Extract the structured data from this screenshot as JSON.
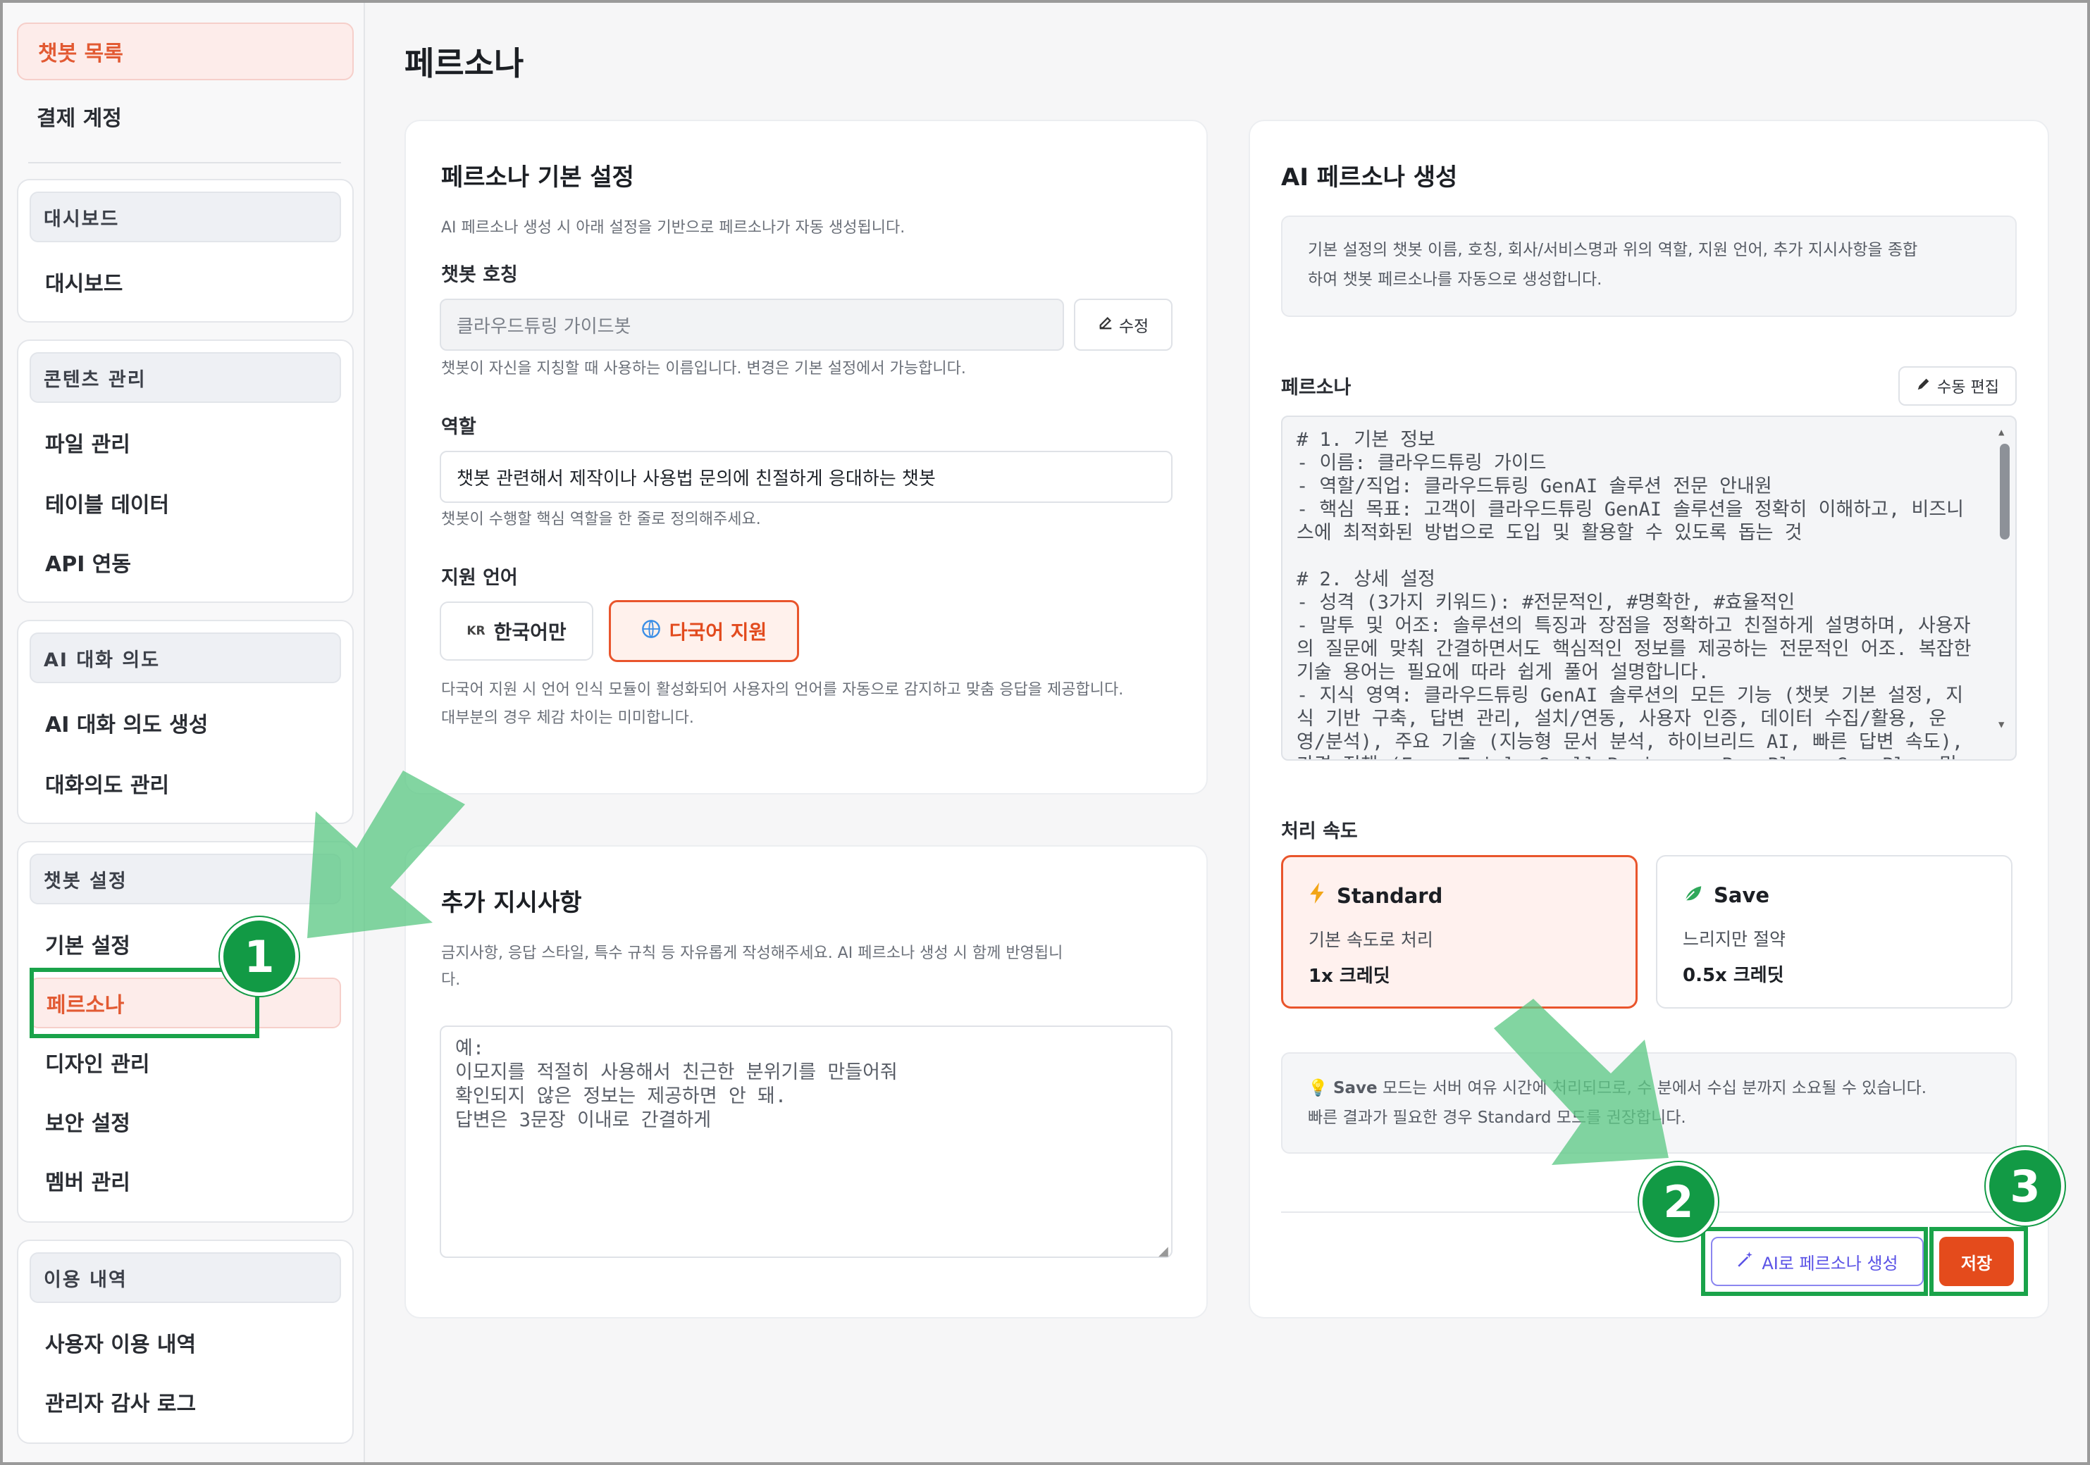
{
  "sidebar": {
    "top_items": [
      {
        "label": "챗봇 목록"
      },
      {
        "label": "결제 계정"
      }
    ],
    "groups": [
      {
        "title": "대시보드",
        "items": [
          "대시보드"
        ]
      },
      {
        "title": "콘텐츠 관리",
        "items": [
          "파일 관리",
          "테이블 데이터",
          "API 연동"
        ]
      },
      {
        "title": "AI 대화 의도",
        "items": [
          "AI 대화 의도 생성",
          "대화의도 관리"
        ]
      },
      {
        "title": "챗봇 설정",
        "items": [
          "기본 설정",
          "페르소나",
          "디자인 관리",
          "보안 설정",
          "멤버 관리"
        ],
        "active_item": "페르소나"
      },
      {
        "title": "이용 내역",
        "items": [
          "사용자 이용 내역",
          "관리자 감사 로그"
        ]
      }
    ]
  },
  "page": {
    "title": "페르소나"
  },
  "basic": {
    "title": "페르소나 기본 설정",
    "intro": "AI 페르소나 생성 시 아래 설정을 기반으로 페르소나가 자동 생성됩니다.",
    "nickname_label": "챗봇 호칭",
    "nickname_value": "클라우드튜링 가이드봇",
    "edit_label": "수정",
    "nickname_hint": "챗봇이 자신을 지칭할 때 사용하는 이름입니다. 변경은 기본 설정에서 가능합니다.",
    "role_label": "역할",
    "role_value": "챗봇 관련해서 제작이나 사용법 문의에 친절하게 응대하는 챗봇",
    "role_hint": "챗봇이 수행할 핵심 역할을 한 줄로 정의해주세요.",
    "lang_label": "지원 언어",
    "lang_korean_tag": "KR",
    "lang_korean": "한국어만",
    "lang_multi": "다국어 지원",
    "lang_hint_1": "다국어 지원 시 언어 인식 모듈이 활성화되어 사용자의 언어를 자동으로 감지하고 맞춤 응답을 제공합니다.",
    "lang_hint_2": "대부분의 경우 체감 차이는 미미합니다."
  },
  "extra": {
    "title": "추가 지시사항",
    "hint_1": "금지사항, 응답 스타일, 특수 규칙 등 자유롭게 작성해주세요. AI 페르소나 생성 시 함께 반영됩니",
    "hint_2": "다.",
    "placeholder": "예:\n이모지를 적절히 사용해서 친근한 분위기를 만들어줘\n확인되지 않은 정보는 제공하면 안 돼.\n답변은 3문장 이내로 간결하게"
  },
  "ai_persona": {
    "title": "AI 페르소나 생성",
    "info_1": "기본 설정의 챗봇 이름, 호칭, 회사/서비스명과 위의 역할, 지원 언어, 추가 지시사항을 종합",
    "info_2": "하여 챗봇 페르소나를 자동으로 생성합니다.",
    "persona_label": "페르소나",
    "manual_edit": "수동 편집",
    "persona_lines": [
      "# 1. 기본 정보",
      "- 이름: 클라우드튜링 가이드",
      "- 역할/직업: 클라우드튜링 GenAI 솔루션 전문 안내원",
      "- 핵심 목표: 고객이 클라우드튜링 GenAI 솔루션을 정확히 이해하고, 비즈니스에 최적화된 방법으로 도입 및 활용할 수 있도록 돕는 것",
      "",
      "# 2. 상세 설정",
      "- 성격 (3가지 키워드): #전문적인, #명확한, #효율적인",
      "- 말투 및 어조: 솔루션의 특징과 장점을 정확하고 친절하게 설명하며, 사용자의 질문에 맞춰 간결하면서도 핵심적인 정보를 제공하는 전문적인 어조. 복잡한 기술 용어는 필요에 따라 쉽게 풀어 설명합니다.",
      "- 지식 영역: 클라우드튜링 GenAI 솔루션의 모든 기능 (챗봇 기본 설정, 지식 기반 구축, 답변 관리, 설치/연동, 사용자 인증, 데이터 수집/활용, 운영/분석), 주요 기술 (지능형 문서 분석, 하이브리드 AI, 빠른 답변 속도), 가격 정책 (Free Trial, Small Business, Pro Plan, Gov Plan 및 추"
    ],
    "speed_label": "처리 속도",
    "speed_standard": {
      "name": "Standard",
      "desc": "기본 속도로 처리",
      "credit": "1x 크레딧"
    },
    "speed_save": {
      "name": "Save",
      "desc": "느리지만 절약",
      "credit": "0.5x 크레딧"
    },
    "notice_1": "Save 모드는 서버 여유 시간에 처리되므로, 수 분에서 수십 분까지 소요될 수 있습니다.",
    "notice_1_bold": "Save",
    "notice_1_rest": " 모드는 서버 여유 시간에 처리되므로, 수 분에서 수십 분까지 소요될 수 있습니다.",
    "notice_2": "빠른 결과가 필요한 경우 Standard 모드를 권장합니다.",
    "generate_button": "AI로 페르소나 생성",
    "save_button": "저장"
  },
  "annotations": {
    "badge_1": "1",
    "badge_2": "2",
    "badge_3": "3"
  },
  "colors": {
    "accent": "#e44b1c",
    "annotation": "#1aa34a",
    "ai_button": "#5a52e6"
  }
}
